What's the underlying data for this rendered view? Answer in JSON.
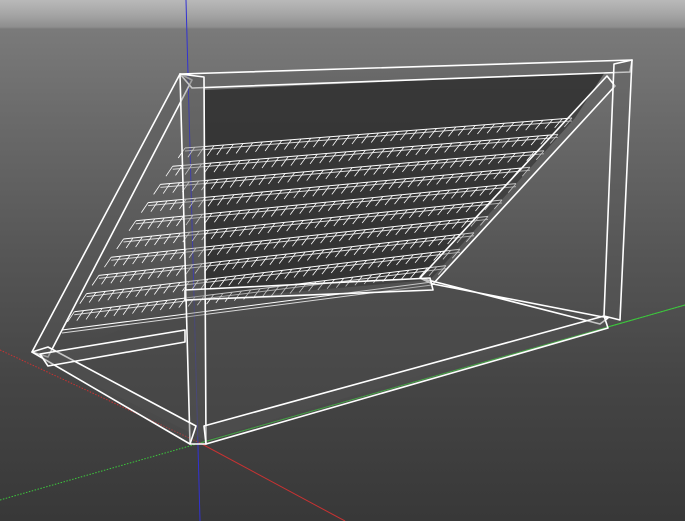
{
  "viewport": {
    "background_top": "#b9b9b9",
    "background_bottom": "#383838",
    "wire_color": "#ffffff",
    "wire_inner_color": "#d8d8d8",
    "frame_fill": "#5a5a5a"
  },
  "axes": {
    "x_color": "#c83232",
    "y_color": "#3cc83c",
    "z_color": "#3232d2"
  },
  "model": {
    "name": "goal-frame-wireframe",
    "net_rows": 10,
    "net_columns": 40
  }
}
